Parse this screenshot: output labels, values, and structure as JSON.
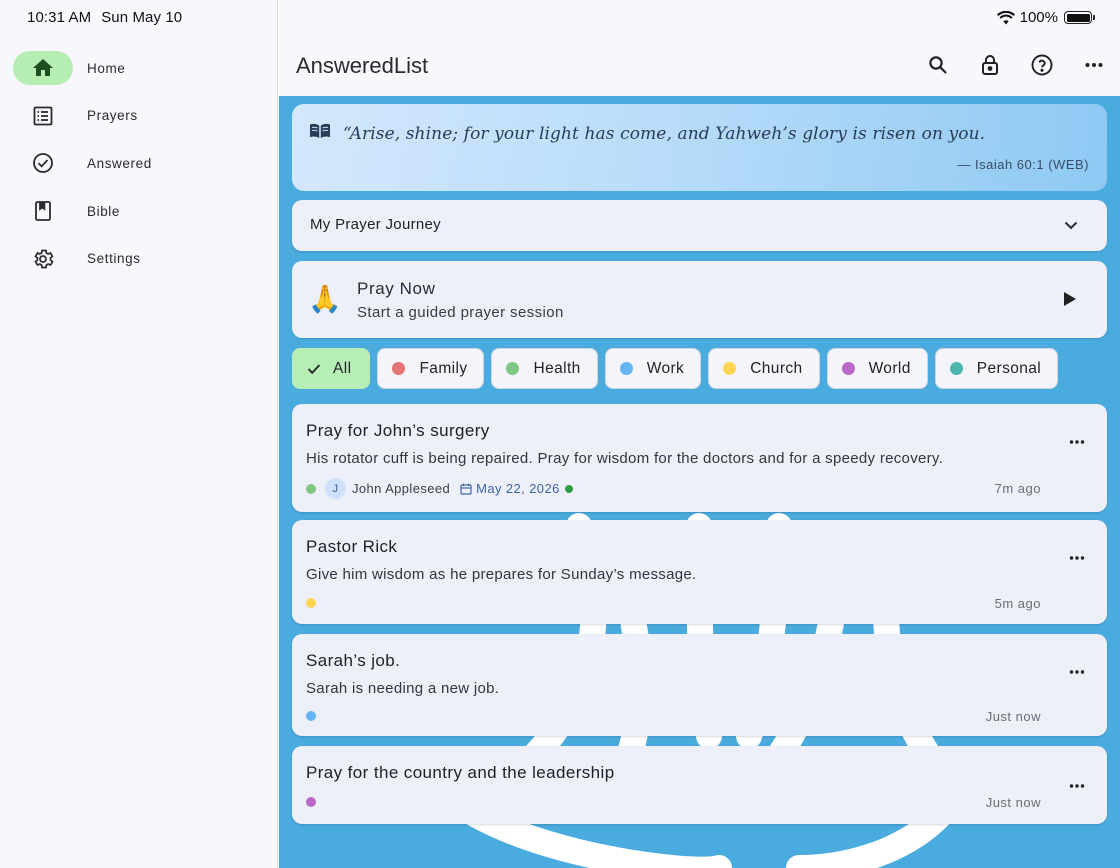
{
  "status": {
    "time": "10:31 AM",
    "date": "Sun May 10",
    "battery": "100%",
    "battery_level": 1.0
  },
  "sidebar": {
    "items": [
      {
        "label": "Home",
        "icon": "home-icon",
        "active": true
      },
      {
        "label": "Prayers",
        "icon": "list-icon",
        "active": false
      },
      {
        "label": "Answered",
        "icon": "check-circle-icon",
        "active": false
      },
      {
        "label": "Bible",
        "icon": "book-icon",
        "active": false
      },
      {
        "label": "Settings",
        "icon": "gear-icon",
        "active": false
      }
    ]
  },
  "header": {
    "title": "AnsweredList",
    "actions": [
      "search-icon",
      "lock-icon",
      "help-icon",
      "more-icon"
    ]
  },
  "verse": {
    "text": "“Arise, shine; for your light has come, and Yahweh’s glory is risen on you.",
    "reference": "— Isaiah 60:1 (WEB)"
  },
  "journey": {
    "title": "My Prayer Journey"
  },
  "pray_now": {
    "emoji": "🙏",
    "title": "Pray Now",
    "subtitle": "Start a guided prayer session"
  },
  "filters": [
    {
      "label": "All",
      "selected": true,
      "color": ""
    },
    {
      "label": "Family",
      "selected": false,
      "color": "#e57373"
    },
    {
      "label": "Health",
      "selected": false,
      "color": "#81c784"
    },
    {
      "label": "Work",
      "selected": false,
      "color": "#64b5f6"
    },
    {
      "label": "Church",
      "selected": false,
      "color": "#ffd54f"
    },
    {
      "label": "World",
      "selected": false,
      "color": "#ba68c8"
    },
    {
      "label": "Personal",
      "selected": false,
      "color": "#4db6ac"
    }
  ],
  "prayers": [
    {
      "title": "Pray for John’s surgery",
      "description": "His rotator cuff is being repaired. Pray for wisdom for the doctors and for a speedy recovery.",
      "category_color": "#81c784",
      "person_initial": "J",
      "person": "John Appleseed",
      "date": "May 22, 2026",
      "time": "7m ago"
    },
    {
      "title": "Pastor Rick",
      "description": "Give him wisdom as he prepares for Sunday’s message.",
      "category_color": "#ffd54f",
      "time": "5m ago"
    },
    {
      "title": "Sarah’s job.",
      "description": "Sarah is needing a new job.",
      "category_color": "#64b5f6",
      "time": "Just now"
    },
    {
      "title": "Pray for the country and the leadership",
      "description": "",
      "category_color": "#ba68c8",
      "time": "Just now"
    }
  ]
}
